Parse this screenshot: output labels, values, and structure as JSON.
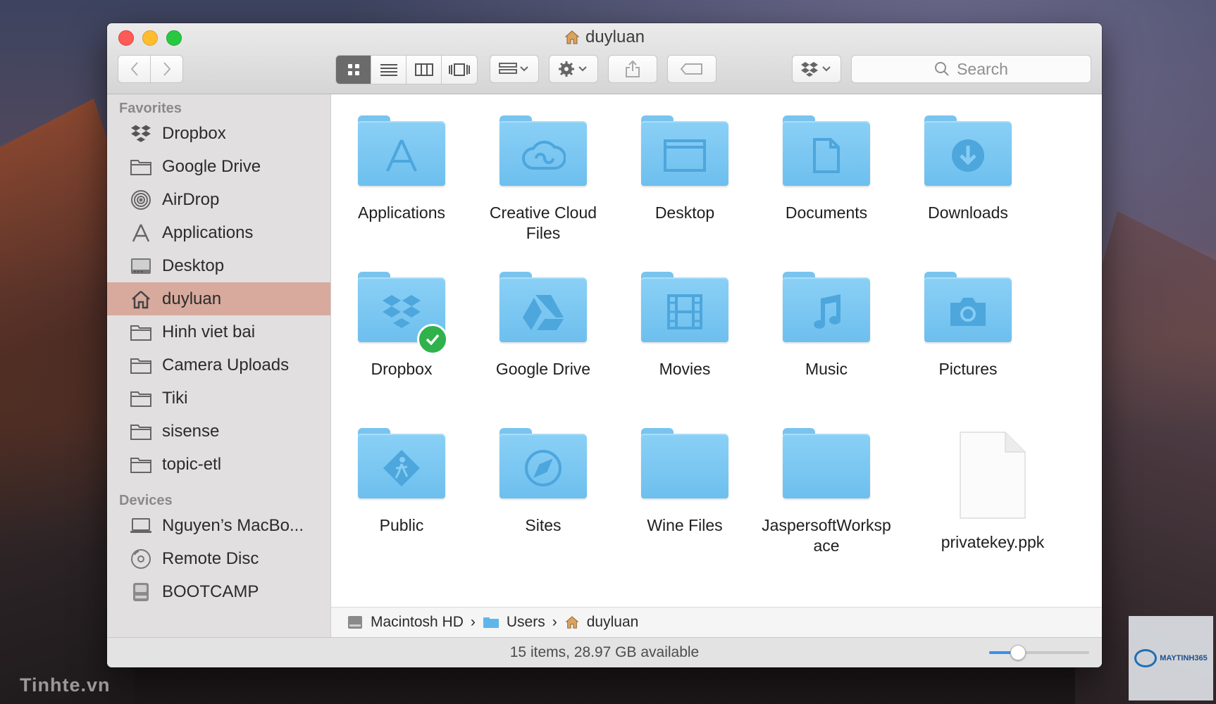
{
  "window": {
    "title": "duyluan"
  },
  "toolbar": {
    "search_placeholder": "Search",
    "view_modes": [
      "icon-view",
      "list-view",
      "column-view",
      "cover-flow-view"
    ],
    "active_view": 0
  },
  "sidebar": {
    "favorites_header": "Favorites",
    "favorites": [
      {
        "label": "Dropbox",
        "icon": "dropbox-icon"
      },
      {
        "label": "Google Drive",
        "icon": "folder-icon"
      },
      {
        "label": "AirDrop",
        "icon": "airdrop-icon"
      },
      {
        "label": "Applications",
        "icon": "applications-icon"
      },
      {
        "label": "Desktop",
        "icon": "desktop-icon"
      },
      {
        "label": "duyluan",
        "icon": "home-icon",
        "selected": true
      },
      {
        "label": "Hinh viet bai",
        "icon": "folder-icon"
      },
      {
        "label": "Camera Uploads",
        "icon": "folder-icon"
      },
      {
        "label": "Tiki",
        "icon": "folder-icon"
      },
      {
        "label": "sisense",
        "icon": "folder-icon"
      },
      {
        "label": "topic-etl",
        "icon": "folder-icon"
      }
    ],
    "devices_header": "Devices",
    "devices": [
      {
        "label": "Nguyen’s MacBo...",
        "icon": "laptop-icon"
      },
      {
        "label": "Remote Disc",
        "icon": "disc-icon"
      },
      {
        "label": "BOOTCAMP",
        "icon": "drive-icon"
      }
    ]
  },
  "files": [
    {
      "label": "Applications",
      "icon": "applications-folder-icon"
    },
    {
      "label": "Creative Cloud Files",
      "icon": "creative-cloud-folder-icon"
    },
    {
      "label": "Desktop",
      "icon": "desktop-folder-icon"
    },
    {
      "label": "Documents",
      "icon": "documents-folder-icon"
    },
    {
      "label": "Downloads",
      "icon": "downloads-folder-icon"
    },
    {
      "label": "Dropbox",
      "icon": "dropbox-folder-icon",
      "synced": true
    },
    {
      "label": "Google Drive",
      "icon": "google-drive-folder-icon"
    },
    {
      "label": "Movies",
      "icon": "movies-folder-icon"
    },
    {
      "label": "Music",
      "icon": "music-folder-icon"
    },
    {
      "label": "Pictures",
      "icon": "pictures-folder-icon"
    },
    {
      "label": "Public",
      "icon": "public-folder-icon"
    },
    {
      "label": "Sites",
      "icon": "sites-folder-icon"
    },
    {
      "label": "Wine Files",
      "icon": "folder-icon"
    },
    {
      "label": "JaspersoftWorksp ace",
      "icon": "folder-icon"
    },
    {
      "label": "privatekey.ppk",
      "icon": "document-icon"
    }
  ],
  "pathbar": {
    "segments": [
      "Macintosh HD",
      "Users",
      "duyluan"
    ],
    "separator": "›"
  },
  "status": {
    "text": "15 items, 28.97 GB available",
    "icon_size_level": 0.28
  },
  "watermarks": {
    "left": "Tinhte.vn",
    "right": "MAYTINH365"
  },
  "colors": {
    "folder": "#79c4ef",
    "selection": "#d7aa9d",
    "sync_badge": "#2fb24b",
    "slider": "#3a8ef0"
  }
}
